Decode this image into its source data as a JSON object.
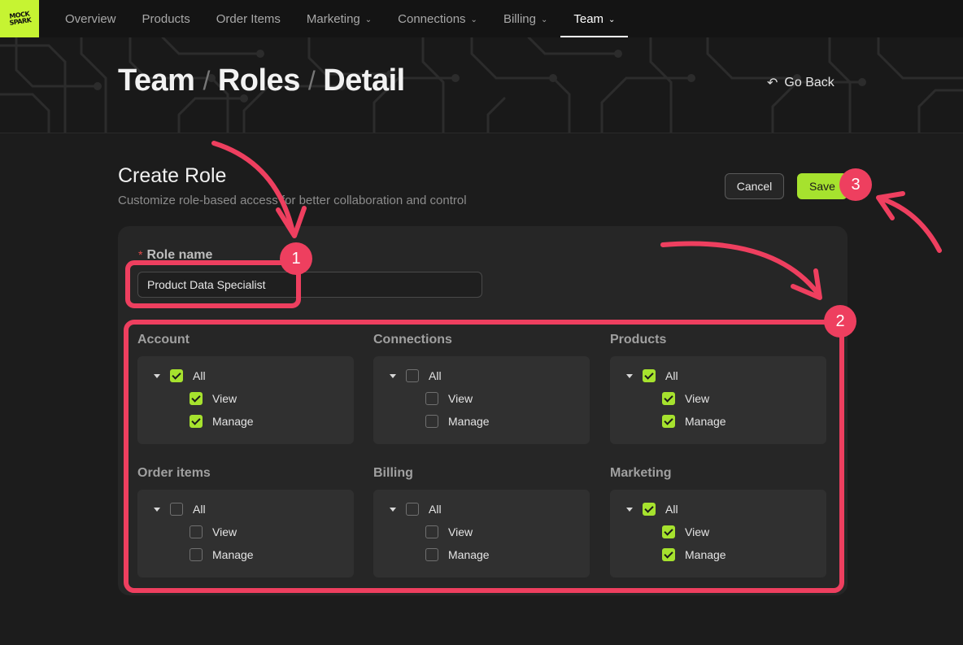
{
  "nav": {
    "logo_text": "MOCK\nSPARK",
    "items": [
      {
        "label": "Overview",
        "dropdown": false,
        "active": false
      },
      {
        "label": "Products",
        "dropdown": false,
        "active": false
      },
      {
        "label": "Order Items",
        "dropdown": false,
        "active": false
      },
      {
        "label": "Marketing",
        "dropdown": true,
        "active": false
      },
      {
        "label": "Connections",
        "dropdown": true,
        "active": false
      },
      {
        "label": "Billing",
        "dropdown": true,
        "active": false
      },
      {
        "label": "Team",
        "dropdown": true,
        "active": true
      }
    ]
  },
  "hero": {
    "breadcrumb": [
      "Team",
      "Roles",
      "Detail"
    ],
    "separator": "/",
    "go_back": "Go Back"
  },
  "header": {
    "title": "Create Role",
    "subtitle": "Customize role-based access for better collaboration and control",
    "cancel": "Cancel",
    "save": "Save"
  },
  "form": {
    "role_name_label": "Role name",
    "required_mark": "*",
    "role_name_value": "Product Data Specialist"
  },
  "permissions": [
    {
      "title": "Account",
      "all_label": "All",
      "all": true,
      "view_label": "View",
      "view": true,
      "manage_label": "Manage",
      "manage": true
    },
    {
      "title": "Connections",
      "all_label": "All",
      "all": false,
      "view_label": "View",
      "view": false,
      "manage_label": "Manage",
      "manage": false
    },
    {
      "title": "Products",
      "all_label": "All",
      "all": true,
      "view_label": "View",
      "view": true,
      "manage_label": "Manage",
      "manage": true
    },
    {
      "title": "Order items",
      "all_label": "All",
      "all": false,
      "view_label": "View",
      "view": false,
      "manage_label": "Manage",
      "manage": false
    },
    {
      "title": "Billing",
      "all_label": "All",
      "all": false,
      "view_label": "View",
      "view": false,
      "manage_label": "Manage",
      "manage": false
    },
    {
      "title": "Marketing",
      "all_label": "All",
      "all": true,
      "view_label": "View",
      "view": true,
      "manage_label": "Manage",
      "manage": true
    }
  ],
  "annotations": {
    "badges": [
      "1",
      "2",
      "3"
    ],
    "color": "#ee3f5f"
  },
  "colors": {
    "accent": "#a6e22e",
    "background": "#1c1c1c",
    "card": "#262626",
    "annotation": "#ee3f5f"
  }
}
